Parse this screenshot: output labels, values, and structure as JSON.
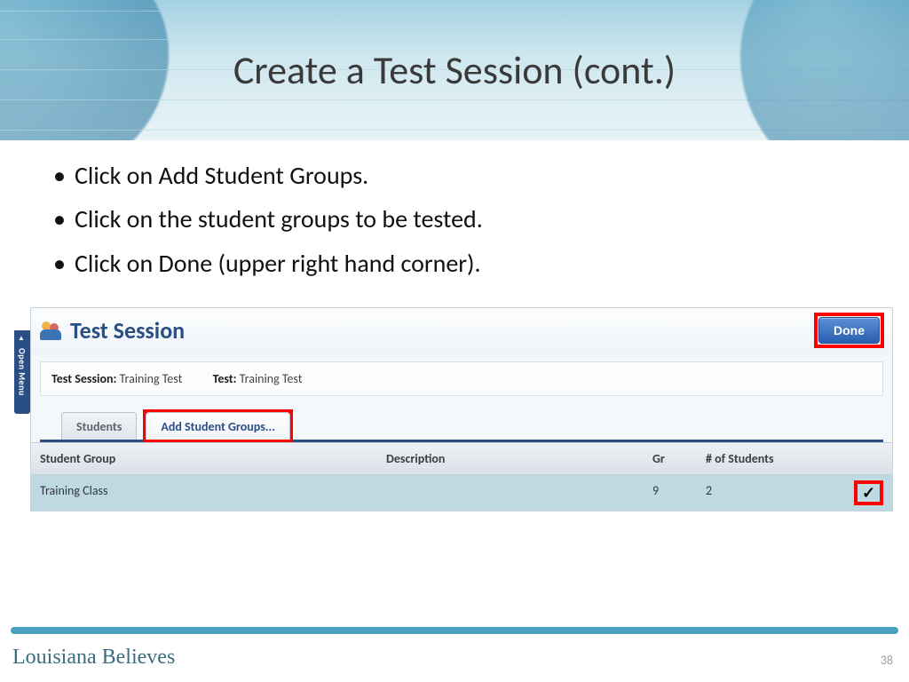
{
  "slide": {
    "title": "Create a Test Session (cont.)",
    "bullets": [
      "Click on Add Student Groups.",
      "Click on the student groups to be tested.",
      "Click on Done (upper right hand corner)."
    ],
    "page_number": "38",
    "brand": "Louisiana Believes"
  },
  "panel": {
    "open_menu_label": "Open Menu",
    "title": "Test Session",
    "done_label": "Done",
    "info": {
      "session_label": "Test Session:",
      "session_value": "Training Test",
      "test_label": "Test:",
      "test_value": "Training Test"
    },
    "tabs": {
      "students": "Students",
      "add_groups": "Add Student Groups..."
    },
    "columns": {
      "group": "Student Group",
      "desc": "Description",
      "grade": "Gr",
      "count": "# of Students"
    },
    "row": {
      "group": "Training Class",
      "desc": "",
      "grade": "9",
      "count": "2",
      "check": "✓"
    }
  }
}
